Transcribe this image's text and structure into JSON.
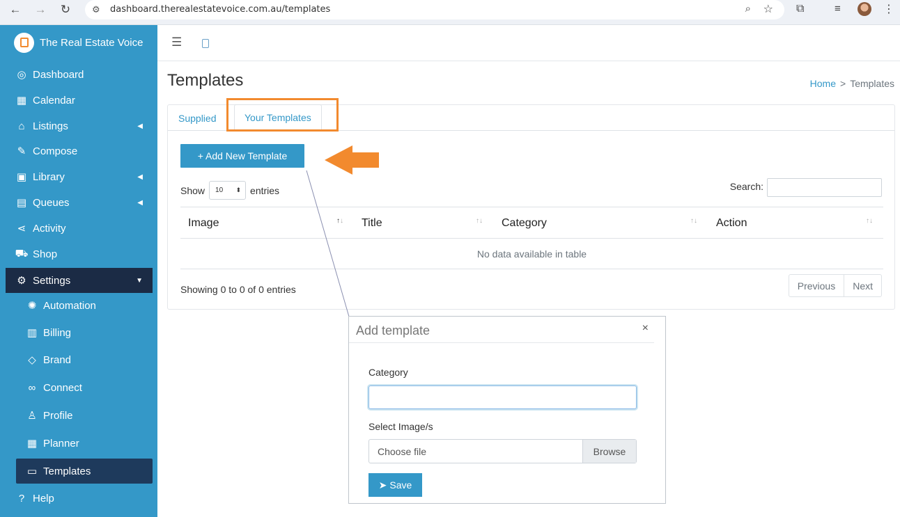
{
  "browser": {
    "url": "dashboard.therealestatevoice.com.au/templates",
    "icons": {
      "back": "arrow-left-icon",
      "forward": "arrow-right-icon",
      "reload": "reload-icon",
      "site_info": "tune-icon",
      "zoom": "zoom-icon",
      "bookmark": "star-icon",
      "extensions": "puzzle-icon",
      "media": "media-icon",
      "menu": "kebab-icon"
    }
  },
  "sidebar": {
    "brand": "The Real Estate Voice",
    "items": [
      {
        "label": "Dashboard",
        "icon": "dashboard-icon"
      },
      {
        "label": "Calendar",
        "icon": "calendar-icon"
      },
      {
        "label": "Listings",
        "icon": "listings-icon",
        "caret": "left"
      },
      {
        "label": "Compose",
        "icon": "compose-icon"
      },
      {
        "label": "Library",
        "icon": "library-icon",
        "caret": "left"
      },
      {
        "label": "Queues",
        "icon": "queues-icon",
        "caret": "left"
      },
      {
        "label": "Activity",
        "icon": "share-icon"
      },
      {
        "label": "Shop",
        "icon": "cart-icon"
      },
      {
        "label": "Settings",
        "icon": "cog-icon",
        "caret": "down"
      }
    ],
    "sub_items": [
      {
        "label": "Automation",
        "icon": "bulb-icon"
      },
      {
        "label": "Billing",
        "icon": "receipt-icon"
      },
      {
        "label": "Brand",
        "icon": "tag-icon"
      },
      {
        "label": "Connect",
        "icon": "link-icon"
      },
      {
        "label": "Profile",
        "icon": "user-icon"
      },
      {
        "label": "Planner",
        "icon": "planner-icon"
      },
      {
        "label": "Templates",
        "icon": "monitor-icon"
      }
    ],
    "help": "Help"
  },
  "page": {
    "title": "Templates",
    "breadcrumb": {
      "home": "Home",
      "separator": ">",
      "current": "Templates"
    }
  },
  "tabs": {
    "supplied": "Supplied",
    "yours": "Your Templates"
  },
  "toolbar": {
    "add_button": "+ Add New Template"
  },
  "table": {
    "show": "Show",
    "page_size": "10",
    "entries": "entries",
    "search_label": "Search:",
    "columns": [
      "Image",
      "Title",
      "Category",
      "Action"
    ],
    "empty": "No data available in table",
    "info": "Showing 0 to 0 of 0 entries",
    "prev": "Previous",
    "next": "Next"
  },
  "modal": {
    "title": "Add template",
    "close": "×",
    "category_label": "Category",
    "category_value": "",
    "image_label": "Select Image/s",
    "file_placeholder": "Choose file",
    "browse": "Browse",
    "save": "Save"
  },
  "colors": {
    "sidebar": "#3498c8",
    "settings_bg": "#1b2b45",
    "active_bg": "#1e3a5c",
    "accent": "#3498c8",
    "annotation": "#f28a2e"
  }
}
